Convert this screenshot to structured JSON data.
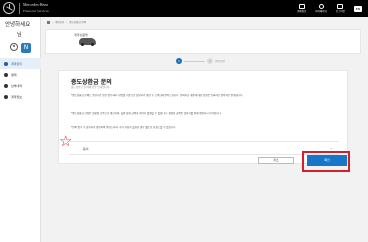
{
  "header": {
    "brand_line1": "Mercedes-Benz",
    "brand_line2": "Financial Services",
    "actions": [
      {
        "icon": "wallet-icon",
        "label": "결제정보"
      },
      {
        "icon": "user-icon",
        "label": "마이페이지"
      },
      {
        "icon": "logout-icon",
        "label": "로그아웃"
      }
    ],
    "lang_badge": "EN"
  },
  "sidebar": {
    "greeting": "안녕하세요",
    "name_suffix": "님",
    "avatar_letter": "N",
    "items": [
      {
        "label": "계약관리",
        "active": true
      },
      {
        "label": "결제",
        "active": false
      },
      {
        "label": "납부내역",
        "active": false
      },
      {
        "label": "계약정보",
        "active": false
      }
    ]
  },
  "breadcrumb": [
    "계약관리",
    "중도상환금 문의"
  ],
  "product": {
    "label": "계약상품명"
  },
  "steps": [
    {
      "num": "1",
      "label": "",
      "active": true
    },
    {
      "num": "2",
      "label": "문의 완료",
      "active": false
    }
  ],
  "form": {
    "title": "중도상환금 문의",
    "subtitle": "중도상환금 문의에 관한 안내입니다.",
    "paragraph1": "*중도상환금 문의는 운영시간 동안 접수되며, 영업일 기준으로 담당자가 확인 후 고객님께 연락드립니다. 문의하신 내용에 대한 답변은 등록하신 연락처로 안내됩니다.",
    "paragraph2": "*중도상환금 산정은 상환일 기준으로 계산되며, 실제 상환 금액과 차이가 발생할 수 있습니다. 정확한 금액은 담당자를 통해 확인하시기 바랍니다.",
    "paragraph3": "*문의 접수 후 담당자가 확인하여 안내드리며, 추가 서류가 필요한 경우 별도로 요청드릴 수 있습니다.",
    "check_label": "동의",
    "cancel_label": "취소",
    "confirm_label": "확인"
  }
}
